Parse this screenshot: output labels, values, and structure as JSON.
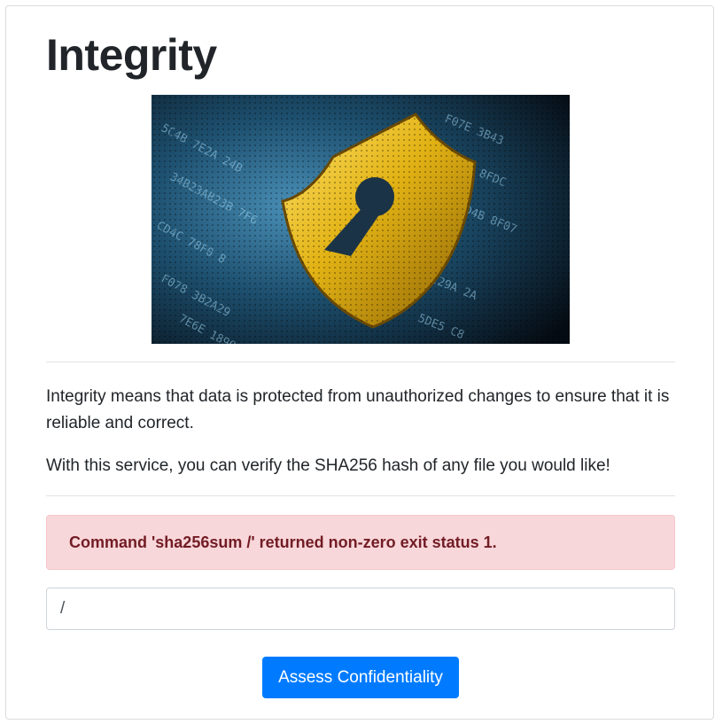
{
  "page": {
    "title": "Integrity"
  },
  "hero": {
    "alt": "Padlock shield over data"
  },
  "content": {
    "paragraph_1": "Integrity means that data is protected from unauthorized changes to ensure that it is reliable and correct.",
    "paragraph_2": "With this service, you can verify the SHA256 hash of any file you would like!"
  },
  "alert": {
    "message": "Command 'sha256sum /' returned non-zero exit status 1."
  },
  "form": {
    "input_value": "/",
    "submit_label": "Assess Confidentiality"
  },
  "colors": {
    "accent": "#007bff",
    "alert_bg": "#f8d7da",
    "alert_text": "#721c24"
  }
}
